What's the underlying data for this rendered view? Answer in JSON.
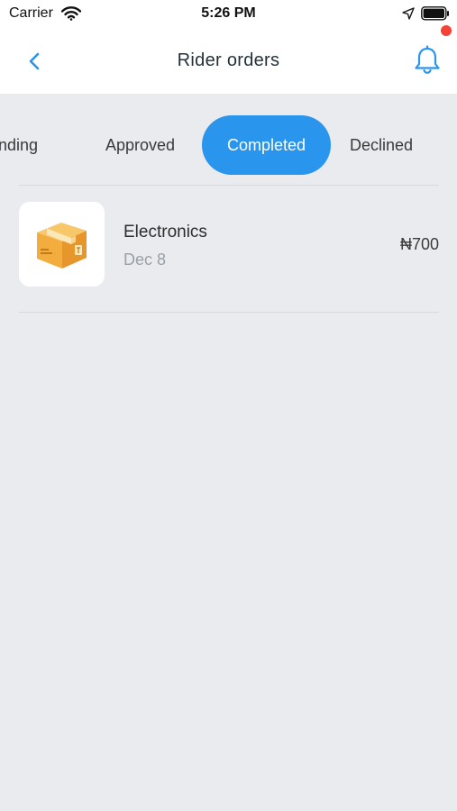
{
  "status_bar": {
    "carrier": "Carrier",
    "time": "5:26 PM"
  },
  "header": {
    "title": "Rider orders",
    "back_icon": "chevron-left-icon",
    "notification_icon": "bell-icon",
    "notification_dot_color": "#f44336"
  },
  "tabs": {
    "items": [
      {
        "label": "Pending",
        "visible_text": "ending",
        "active": false
      },
      {
        "label": "Approved",
        "active": false
      },
      {
        "label": "Completed",
        "active": true
      },
      {
        "label": "Declined",
        "active": false
      }
    ],
    "active_color": "#2a95ec"
  },
  "orders": [
    {
      "name": "Electronics",
      "date": "Dec 8",
      "price": "₦700",
      "icon": "package-box-icon"
    }
  ]
}
